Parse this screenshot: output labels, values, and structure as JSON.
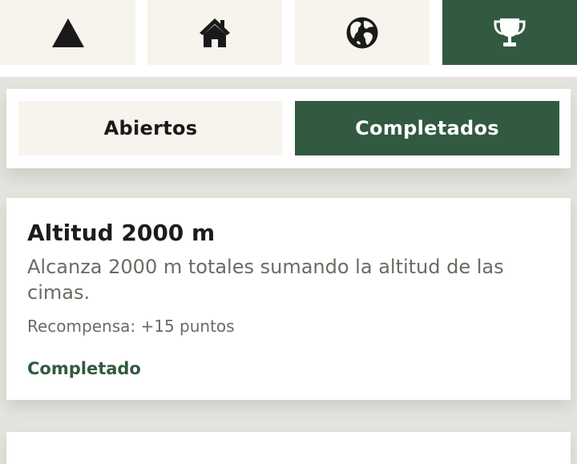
{
  "nav": {
    "tabs": [
      {
        "icon": "mountain-icon",
        "active": false
      },
      {
        "icon": "home-icon",
        "active": false
      },
      {
        "icon": "globe-icon",
        "active": false
      },
      {
        "icon": "trophy-icon",
        "active": true
      }
    ]
  },
  "filter": {
    "open_label": "Abiertos",
    "completed_label": "Completados",
    "selected": "Completados"
  },
  "achievements": [
    {
      "title": "Altitud 2000 m",
      "description": "Alcanza 2000 m totales sumando la altitud de las cimas.",
      "reward": "Recompensa: +15 puntos",
      "status": "Completado"
    }
  ],
  "colors": {
    "accent": "#325a40",
    "tab_background": "#f6f4ec",
    "page_background": "#e4e3dd",
    "muted_text": "#6c6a63"
  }
}
